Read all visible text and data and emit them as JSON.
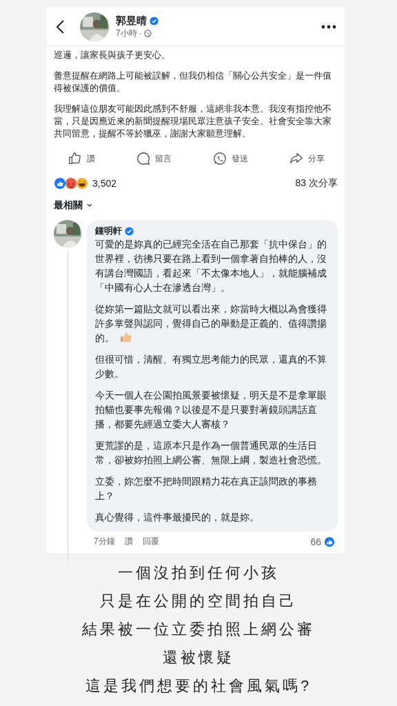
{
  "header": {
    "author": "郭昱晴",
    "verified": true,
    "time": "7小時 ·"
  },
  "post": {
    "paragraphs": [
      "巡邏，讓家長與孩子更安心。",
      "善意提醒在網路上可能被誤解，但我仍相信「關心公共安全」是一件值得被保護的價值。",
      "我理解這位朋友可能因此感到不舒服，這絕非我本意。我沒有指控他不當，只是因應近來的新聞提醒現場民眾注意孩子安全。社會安全靠大家共同留意，提醒不等於獵巫，謝謝大家願意理解。"
    ]
  },
  "actions": [
    {
      "kind": "like",
      "label": "讚"
    },
    {
      "kind": "comment",
      "label": "留言"
    },
    {
      "kind": "send",
      "label": "發送"
    },
    {
      "kind": "share",
      "label": "分享"
    }
  ],
  "reactions": {
    "count": "3,502",
    "shares": "83 次分享"
  },
  "sort": {
    "label": "最相關"
  },
  "comment": {
    "author": "鍾明軒",
    "verified": true,
    "paragraphs": [
      {
        "text": "可愛的是妳真的已經完全活在自己那套「抗中保台」的世界裡，彷彿只要在路上看到一個拿著自拍棒的人，沒有講台灣國語，看起來「不太像本地人」，就能腦補成「中國有心人士在滲透台灣」。",
        "thumb": false
      },
      {
        "text": "從妳第一篇貼文就可以看出來，妳當時大概以為會獲得許多掌聲與認同，覺得自己的舉動是正義的、值得讚揚的。",
        "thumb": true
      },
      {
        "text": "但很可惜，清醒、有獨立思考能力的民眾，還真的不算少數。",
        "thumb": false
      },
      {
        "text": "今天一個人在公園拍風景要被懷疑，明天是不是拿單眼拍貓也要事先報備？以後是不是只要對著鏡頭講話直播，都要先經過立委大人審核？",
        "thumb": false
      },
      {
        "text": "更荒謬的是，這原本只是作為一個普通民眾的生活日常，卻被妳拍照上網公審、無限上綱，製造社會恐慌。",
        "thumb": false
      },
      {
        "text": "立委，妳怎麼不把時間跟精力花在真正該問政的事務上？",
        "thumb": false
      },
      {
        "text": "真心覺得，這件事最擾民的，就是妳。",
        "thumb": false
      }
    ],
    "time": "7分鐘",
    "actions": [
      "讚",
      "回覆"
    ],
    "likes": "66"
  },
  "caption": {
    "lines": [
      "一個沒拍到任何小孩",
      "只是在公開的空間拍自己",
      "結果被一位立委拍照上網公審",
      "還被懷疑",
      "這是我們想要的社會風氣嗎?"
    ]
  }
}
